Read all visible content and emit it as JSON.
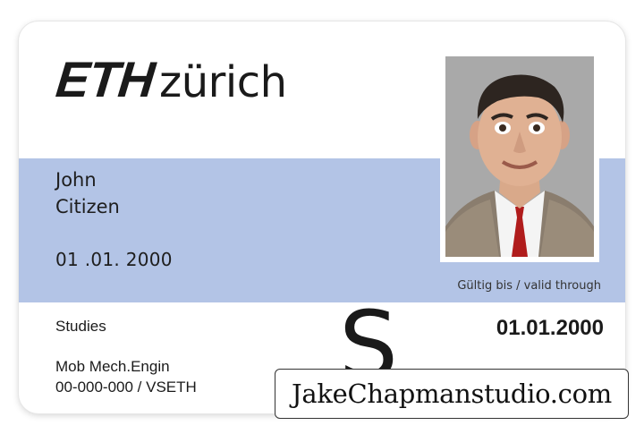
{
  "card": {
    "logo": {
      "eth": "ETH",
      "zurich": "zürich"
    },
    "holder": {
      "first_name": "John",
      "last_name": "Citizen",
      "birth_date": "01 .01.  2000"
    },
    "validity": {
      "label": "Gültig bis / valid through",
      "date": "01.01.2000"
    },
    "studies": {
      "label": "Studies",
      "program": "Mob Mech.Engin",
      "number": "00-000-000 / VSETH"
    },
    "category_letter": "S"
  },
  "watermark": {
    "text": "JakeChapmanstudio.com"
  },
  "colors": {
    "band": "#b3c4e6",
    "photo_background": "#a9a9a9",
    "text": "#1a1a1a"
  },
  "icons": {
    "portrait": "portrait-photo"
  }
}
